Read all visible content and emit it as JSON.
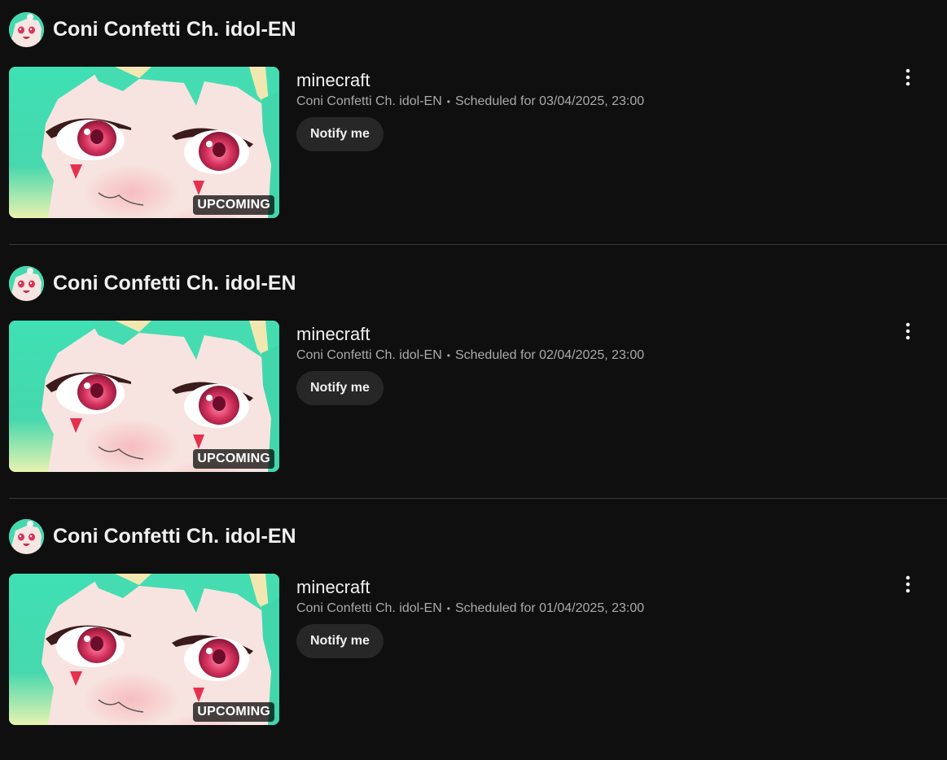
{
  "colors": {
    "background": "#0f0f0f",
    "button_bg": "#272727",
    "meta_text": "#aaaaaa",
    "hair": "#3ed9b0",
    "eye": "#d5285c"
  },
  "icons": {
    "more": "more-vert-icon"
  },
  "sections": [
    {
      "channel": "Coni Confetti Ch. idol-EN",
      "title": "minecraft",
      "meta_channel": "Coni Confetti Ch. idol-EN",
      "separator": "•",
      "schedule": "Scheduled for 03/04/2025, 23:00",
      "badge": "UPCOMING",
      "notify": "Notify me"
    },
    {
      "channel": "Coni Confetti Ch. idol-EN",
      "title": "minecraft",
      "meta_channel": "Coni Confetti Ch. idol-EN",
      "separator": "•",
      "schedule": "Scheduled for 02/04/2025, 23:00",
      "badge": "UPCOMING",
      "notify": "Notify me"
    },
    {
      "channel": "Coni Confetti Ch. idol-EN",
      "title": "minecraft",
      "meta_channel": "Coni Confetti Ch. idol-EN",
      "separator": "•",
      "schedule": "Scheduled for 01/04/2025, 23:00",
      "badge": "UPCOMING",
      "notify": "Notify me"
    }
  ]
}
